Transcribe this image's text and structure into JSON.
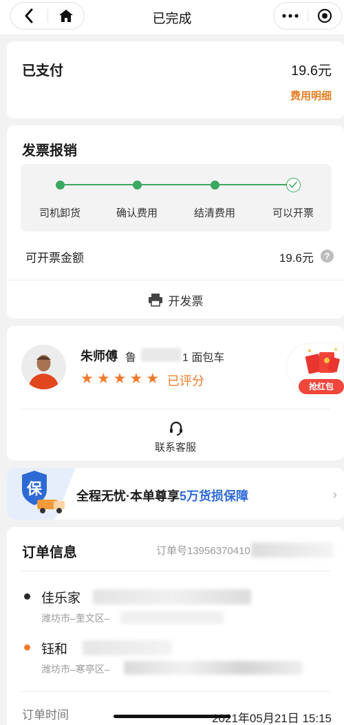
{
  "nav": {
    "title": "已完成",
    "back_icon": "chevron-left-icon",
    "home_icon": "home-icon",
    "more_icon": "more-dots-icon",
    "close_icon": "target-circle-icon"
  },
  "payment": {
    "label": "已支付",
    "amount": "19.6元",
    "detail_link": "费用明细"
  },
  "invoice": {
    "title": "发票报销",
    "steps": [
      "司机卸货",
      "确认费用",
      "结清费用",
      "可以开票"
    ],
    "amount_label": "可开票金额",
    "amount_value": "19.6元",
    "help": "?",
    "open_button": "开发票"
  },
  "driver": {
    "name": "朱师傅",
    "plate_prefix": "鲁",
    "plate_suffix": "1",
    "vehicle": "面包车",
    "rating_stars": 5,
    "rated_text": "已评分",
    "hongbao_label": "抢红包",
    "service_label": "联系客服"
  },
  "guarantee": {
    "shield_char": "保",
    "text_before": "全程无忧·本单尊享",
    "text_highlight": "5万货损保障"
  },
  "order": {
    "title": "订单信息",
    "order_no": "订单号13956370410",
    "start_name": "佳乐家",
    "start_area": "潍坊市–奎文区–",
    "end_name": "钰和",
    "end_area": "潍坊市–寒亭区–",
    "time_label": "订单时间",
    "time_value": "2021年05月21日 15:15"
  },
  "colors": {
    "accent_orange": "#f07a2a",
    "progress_green": "#3aa860",
    "highlight_blue": "#2d6ad6"
  }
}
